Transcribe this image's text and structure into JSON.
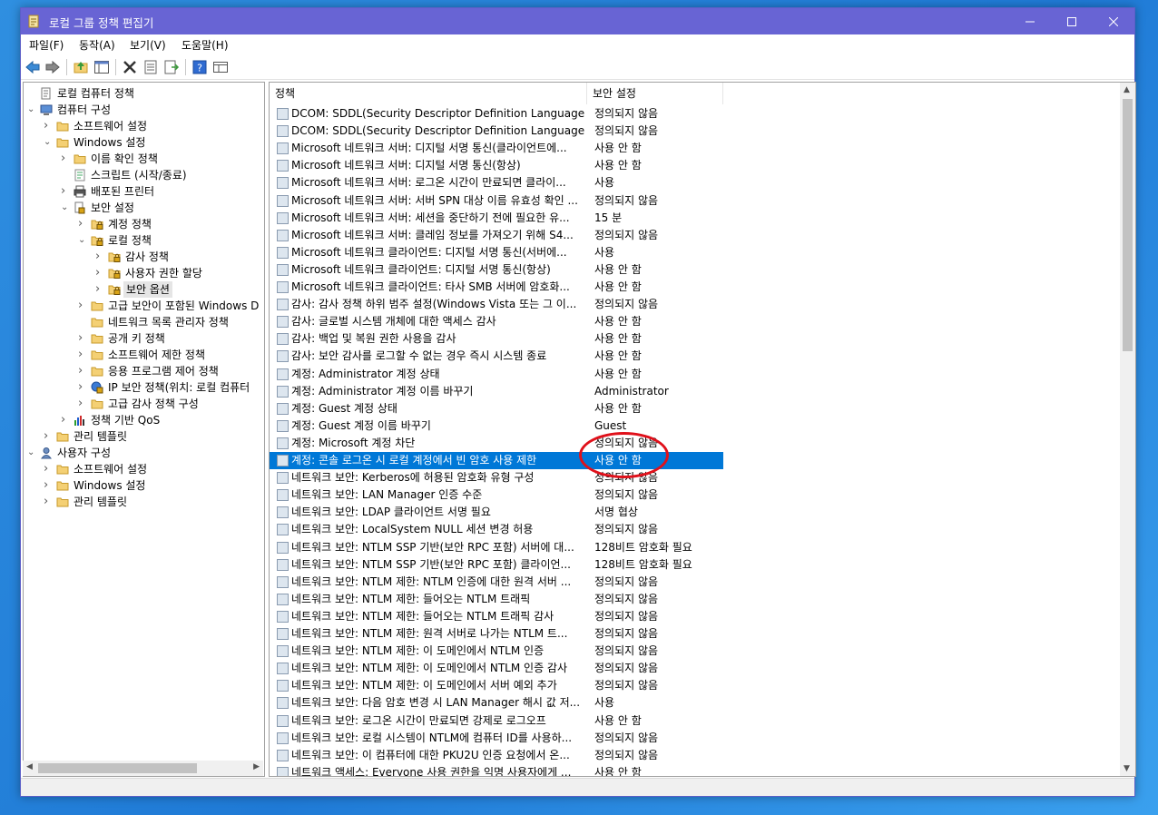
{
  "window": {
    "title": "로컬 그룹 정책 편집기",
    "controls": [
      "minimize",
      "maximize",
      "close"
    ]
  },
  "menu": [
    "파일(F)",
    "동작(A)",
    "보기(V)",
    "도움말(H)"
  ],
  "toolbar": {
    "buttons": [
      "back-icon",
      "forward-icon",
      "up-folder-icon",
      "show-hide-tree-icon",
      "delete-icon",
      "properties-icon",
      "export-list-icon",
      "help-icon",
      "view-icon"
    ]
  },
  "tree": [
    {
      "label": "로컬 컴퓨터 정책",
      "icon": "policy-icon"
    },
    {
      "label": "컴퓨터 구성",
      "icon": "computer-icon"
    },
    {
      "label": "소프트웨어 설정",
      "icon": "folder-icon"
    },
    {
      "label": "Windows 설정",
      "icon": "folder-icon"
    },
    {
      "label": "이름 확인 정책",
      "icon": "folder-icon"
    },
    {
      "label": "스크립트 (시작/종료)",
      "icon": "script-icon"
    },
    {
      "label": "배포된 프린터",
      "icon": "printer-icon"
    },
    {
      "label": "보안 설정",
      "icon": "security-icon"
    },
    {
      "label": "계정 정책",
      "icon": "folder-lock-icon"
    },
    {
      "label": "로컬 정책",
      "icon": "folder-lock-icon"
    },
    {
      "label": "감사 정책",
      "icon": "folder-lock-icon"
    },
    {
      "label": "사용자 권한 할당",
      "icon": "folder-lock-icon"
    },
    {
      "label": "보안 옵션",
      "icon": "folder-lock-icon"
    },
    {
      "label": "고급 보안이 포함된 Windows D",
      "icon": "folder-icon"
    },
    {
      "label": "네트워크 목록 관리자 정책",
      "icon": "folder-icon"
    },
    {
      "label": "공개 키 정책",
      "icon": "folder-icon"
    },
    {
      "label": "소프트웨어 제한 정책",
      "icon": "folder-icon"
    },
    {
      "label": "응용 프로그램 제어 정책",
      "icon": "folder-icon"
    },
    {
      "label": "IP 보안 정책(위치: 로컬 컴퓨터",
      "icon": "ip-security-icon"
    },
    {
      "label": "고급 감사 정책 구성",
      "icon": "folder-icon"
    },
    {
      "label": "정책 기반 QoS",
      "icon": "chart-icon"
    },
    {
      "label": "관리 템플릿",
      "icon": "folder-icon"
    },
    {
      "label": "사용자 구성",
      "icon": "user-icon"
    },
    {
      "label": "소프트웨어 설정",
      "icon": "folder-icon"
    },
    {
      "label": "Windows 설정",
      "icon": "folder-icon"
    },
    {
      "label": "관리 템플릿",
      "icon": "folder-icon"
    }
  ],
  "list": {
    "headers": {
      "policy": "정책",
      "setting": "보안 설정"
    },
    "rows": [
      {
        "policy": "DCOM: SDDL(Security Descriptor Definition Language) 구...",
        "value": "정의되지 않음"
      },
      {
        "policy": "DCOM: SDDL(Security Descriptor Definition Language) 구...",
        "value": "정의되지 않음"
      },
      {
        "policy": "Microsoft 네트워크 서버: 디지털 서명 통신(클라이언트에...",
        "value": "사용 안 함"
      },
      {
        "policy": "Microsoft 네트워크 서버: 디지털 서명 통신(항상)",
        "value": "사용 안 함"
      },
      {
        "policy": "Microsoft 네트워크 서버: 로그온 시간이 만료되면 클라이...",
        "value": "사용"
      },
      {
        "policy": "Microsoft 네트워크 서버: 서버 SPN 대상 이름 유효성 확인 ...",
        "value": "정의되지 않음"
      },
      {
        "policy": "Microsoft 네트워크 서버: 세션을 중단하기 전에 필요한 유...",
        "value": "15 분"
      },
      {
        "policy": "Microsoft 네트워크 서버: 클레임 정보를 가져오기 위해 S4...",
        "value": "정의되지 않음"
      },
      {
        "policy": "Microsoft 네트워크 클라이언트: 디지털 서명 통신(서버에...",
        "value": "사용"
      },
      {
        "policy": "Microsoft 네트워크 클라이언트: 디지털 서명 통신(항상)",
        "value": "사용 안 함"
      },
      {
        "policy": "Microsoft 네트워크 클라이언트: 타사 SMB 서버에 암호화...",
        "value": "사용 안 함"
      },
      {
        "policy": "감사: 감사 정책 하위 범주 설정(Windows Vista 또는 그 이...",
        "value": "정의되지 않음"
      },
      {
        "policy": "감사: 글로벌 시스템 개체에 대한 액세스 감사",
        "value": "사용 안 함"
      },
      {
        "policy": "감사: 백업 및 복원 권한 사용을 감사",
        "value": "사용 안 함"
      },
      {
        "policy": "감사: 보안 감사를 로그할 수 없는 경우 즉시 시스템 종료",
        "value": "사용 안 함"
      },
      {
        "policy": "계정: Administrator 계정 상태",
        "value": "사용 안 함"
      },
      {
        "policy": "계정: Administrator 계정 이름 바꾸기",
        "value": "Administrator"
      },
      {
        "policy": "계정: Guest 계정 상태",
        "value": "사용 안 함"
      },
      {
        "policy": "계정: Guest 계정 이름 바꾸기",
        "value": "Guest"
      },
      {
        "policy": "계정: Microsoft 계정 차단",
        "value": "정의되지 않음"
      },
      {
        "policy": "계정: 콘솔 로그온 시 로컬 계정에서 빈 암호 사용 제한",
        "value": "사용 안 함"
      },
      {
        "policy": "네트워크 보안: Kerberos에 허용된 암호화 유형 구성",
        "value": "정의되지 않음"
      },
      {
        "policy": "네트워크 보안: LAN Manager 인증 수준",
        "value": "정의되지 않음"
      },
      {
        "policy": "네트워크 보안: LDAP 클라이언트 서명 필요",
        "value": "서명 협상"
      },
      {
        "policy": "네트워크 보안: LocalSystem NULL 세션 변경 허용",
        "value": "정의되지 않음"
      },
      {
        "policy": "네트워크 보안: NTLM SSP 기반(보안 RPC 포함) 서버에 대...",
        "value": "128비트 암호화 필요"
      },
      {
        "policy": "네트워크 보안: NTLM SSP 기반(보안 RPC 포함) 클라이언...",
        "value": "128비트 암호화 필요"
      },
      {
        "policy": "네트워크 보안: NTLM 제한: NTLM 인증에 대한 원격 서버 ...",
        "value": "정의되지 않음"
      },
      {
        "policy": "네트워크 보안: NTLM 제한: 들어오는 NTLM 트래픽",
        "value": "정의되지 않음"
      },
      {
        "policy": "네트워크 보안: NTLM 제한: 들어오는 NTLM 트래픽 감사",
        "value": "정의되지 않음"
      },
      {
        "policy": "네트워크 보안: NTLM 제한: 원격 서버로 나가는 NTLM 트...",
        "value": "정의되지 않음"
      },
      {
        "policy": "네트워크 보안: NTLM 제한: 이 도메인에서 NTLM 인증",
        "value": "정의되지 않음"
      },
      {
        "policy": "네트워크 보안: NTLM 제한: 이 도메인에서 NTLM 인증 감사",
        "value": "정의되지 않음"
      },
      {
        "policy": "네트워크 보안: NTLM 제한: 이 도메인에서 서버 예외 추가",
        "value": "정의되지 않음"
      },
      {
        "policy": "네트워크 보안: 다음 암호 변경 시 LAN Manager 해시 값 저...",
        "value": "사용"
      },
      {
        "policy": "네트워크 보안: 로그온 시간이 만료되면 강제로 로그오프",
        "value": "사용 안 함"
      },
      {
        "policy": "네트워크 보안: 로컬 시스템이 NTLM에 컴퓨터 ID를 사용하...",
        "value": "정의되지 않음"
      },
      {
        "policy": "네트워크 보안: 이 컴퓨터에 대한 PKU2U 인증 요청에서 온...",
        "value": "정의되지 않음"
      },
      {
        "policy": "네트워크 액세스: Everyone 사용 권한을 익명 사용자에게 ...",
        "value": "사용 안 함"
      }
    ]
  },
  "colors": {
    "titlebar": "#6864d4",
    "selection": "#0078d7",
    "annotation_circle": "#e0101a"
  }
}
